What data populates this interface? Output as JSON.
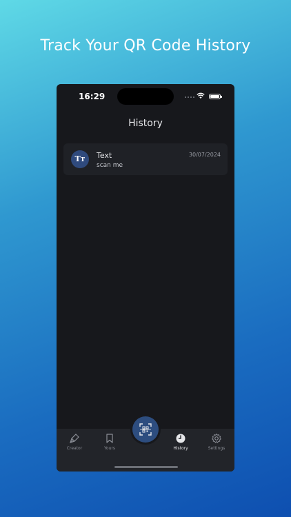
{
  "headline": "Track Your QR Code History",
  "status_bar": {
    "time": "16:29"
  },
  "screen": {
    "title": "History"
  },
  "history": [
    {
      "avatar": "Tт",
      "type": "Text",
      "content": "scan me",
      "date": "30/07/2024"
    }
  ],
  "tabbar": {
    "tabs": [
      {
        "label": "Creator",
        "icon": "brush-icon"
      },
      {
        "label": "Yours",
        "icon": "bookmark-icon"
      },
      {
        "label": "History",
        "icon": "clock-icon",
        "active": true
      },
      {
        "label": "Settings",
        "icon": "gear-icon"
      }
    ],
    "scan_icon": "qr-scan-icon"
  },
  "colors": {
    "accent": "#2d4d7f",
    "phone_bg": "#17181c",
    "card_bg": "#1f2126",
    "tabbar_bg": "#222429"
  }
}
